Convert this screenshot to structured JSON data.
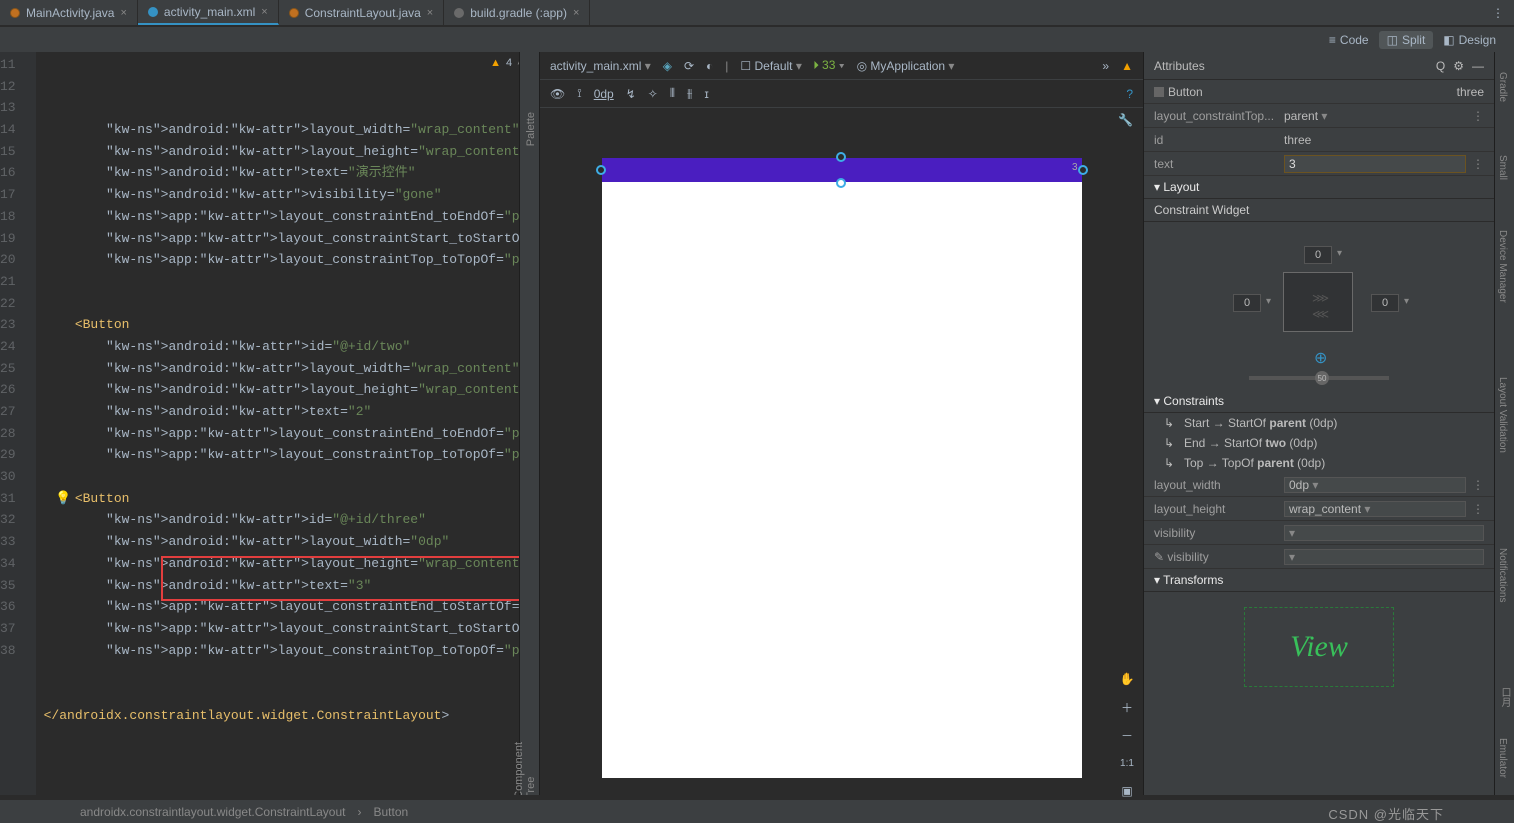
{
  "tabs": [
    {
      "label": "MainActivity.java",
      "icon": "java"
    },
    {
      "label": "activity_main.xml",
      "icon": "xml",
      "active": true,
      "modified": true
    },
    {
      "label": "ConstraintLayout.java",
      "icon": "java"
    },
    {
      "label": "build.gradle (:app)",
      "icon": "gradle"
    }
  ],
  "view_modes": {
    "code": "Code",
    "split": "Split",
    "design": "Design",
    "active": "Split"
  },
  "warnings": {
    "count": "4"
  },
  "code_lines": {
    "first": 11,
    "bulb_at": 31,
    "lines": [
      "        android:layout_width=\"wrap_content\"",
      "        android:layout_height=\"wrap_content\"",
      "        android:text=\"演示控件\"",
      "        android:visibility=\"gone\"",
      "        app:layout_constraintEnd_toEndOf=\"parent\"",
      "        app:layout_constraintStart_toStartOf=\"parent\"",
      "        app:layout_constraintTop_toTopOf=\"parent\" />",
      "",
      "",
      "    <Button",
      "        android:id=\"@+id/two\"",
      "        android:layout_width=\"wrap_content\"",
      "        android:layout_height=\"wrap_content\"",
      "        android:text=\"2\"",
      "        app:layout_constraintEnd_toEndOf=\"parent\"",
      "        app:layout_constraintTop_toTopOf=\"parent\" />",
      "",
      "    <Button",
      "        android:id=\"@+id/three\"",
      "        android:layout_width=\"0dp\"",
      "        android:layout_height=\"wrap_content\"",
      "        android:text=\"3\"",
      "        app:layout_constraintEnd_toStartOf=\"@+id/two\"",
      "        app:layout_constraintStart_toStartOf=\"parent\"",
      "        app:layout_constraintTop_toTopOf=\"parent\" />",
      "",
      "",
      "</androidx.constraintlayout.widget.ConstraintLayout>"
    ]
  },
  "design_toolbar": {
    "file": "activity_main.xml",
    "device": "Default",
    "api": "33",
    "theme": "MyApplication"
  },
  "toolbar2": {
    "zero_dp": "0dp"
  },
  "attributes": {
    "title": "Attributes",
    "component": "Button",
    "component_name": "three",
    "rows": {
      "layout_constraintTop": {
        "label": "layout_constraintTop...",
        "value": "parent"
      },
      "id": {
        "label": "id",
        "value": "three"
      },
      "text": {
        "label": "text",
        "value": "3"
      }
    },
    "sections": {
      "layout": "Layout",
      "constraint_widget": "Constraint Widget",
      "constraints": "Constraints",
      "transforms": "Transforms"
    },
    "margins": {
      "top": "0",
      "left": "0",
      "right": "0",
      "bottom_knob": "50"
    },
    "constraint_lines": [
      {
        "from": "Start",
        "to": "StartOf",
        "target": "parent",
        "dp": "(0dp)"
      },
      {
        "from": "End",
        "to": "StartOf",
        "target": "two",
        "dp": "(0dp)"
      },
      {
        "from": "Top",
        "to": "TopOf",
        "target": "parent",
        "dp": "(0dp)"
      }
    ],
    "props": {
      "layout_width": {
        "label": "layout_width",
        "value": "0dp"
      },
      "layout_height": {
        "label": "layout_height",
        "value": "wrap_content"
      },
      "visibility": {
        "label": "visibility",
        "value": ""
      },
      "tool_visibility": {
        "label": "visibility",
        "value": ""
      }
    },
    "view_preview": "View"
  },
  "side_labels": {
    "palette": "Palette",
    "component_tree": "Component Tree"
  },
  "right_rail": [
    "Gradle",
    "Small",
    "Device Manager",
    "Layout Validation",
    "Notifications",
    "口月",
    "Emulator"
  ],
  "breadcrumb": {
    "path": "androidx.constraintlayout.widget.ConstraintLayout",
    "leaf": "Button"
  },
  "design_canvas": {
    "label": "3"
  },
  "watermark": "CSDN @光临天下"
}
